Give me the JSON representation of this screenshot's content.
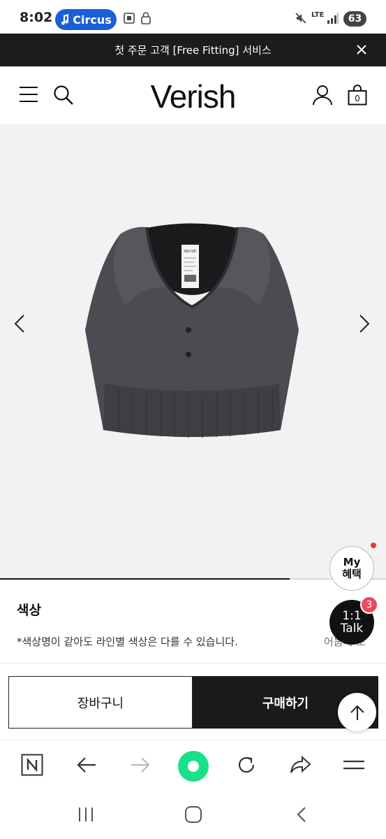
{
  "status_bar": {
    "time": "8:02",
    "app_pill": "Circus",
    "network": "LTE",
    "battery": "63"
  },
  "promo": {
    "text": "첫 주문 고객 [Free Fitting] 서비스"
  },
  "header": {
    "logo": "Verish"
  },
  "gallery": {
    "label_brand": "Verish",
    "image_progress": 0.75
  },
  "product": {
    "color_title": "색상",
    "color_note": "*색상명이 같아도 라인별 색상은 다를 수 있습니다.",
    "color_note_right": "어둡게 보"
  },
  "floating": {
    "my_benefit_line1": "My",
    "my_benefit_line2": "혜택",
    "talk_line1": "1:1",
    "talk_line2": "Talk",
    "talk_badge": "3"
  },
  "actions": {
    "cart_label": "장바구니",
    "buy_label": "구매하기"
  },
  "colors": {
    "banner_bg": "#1c1c1c",
    "accent_blue": "#1a5fd8",
    "browser_green": "#18e18a",
    "badge_red": "#e84a5f"
  }
}
